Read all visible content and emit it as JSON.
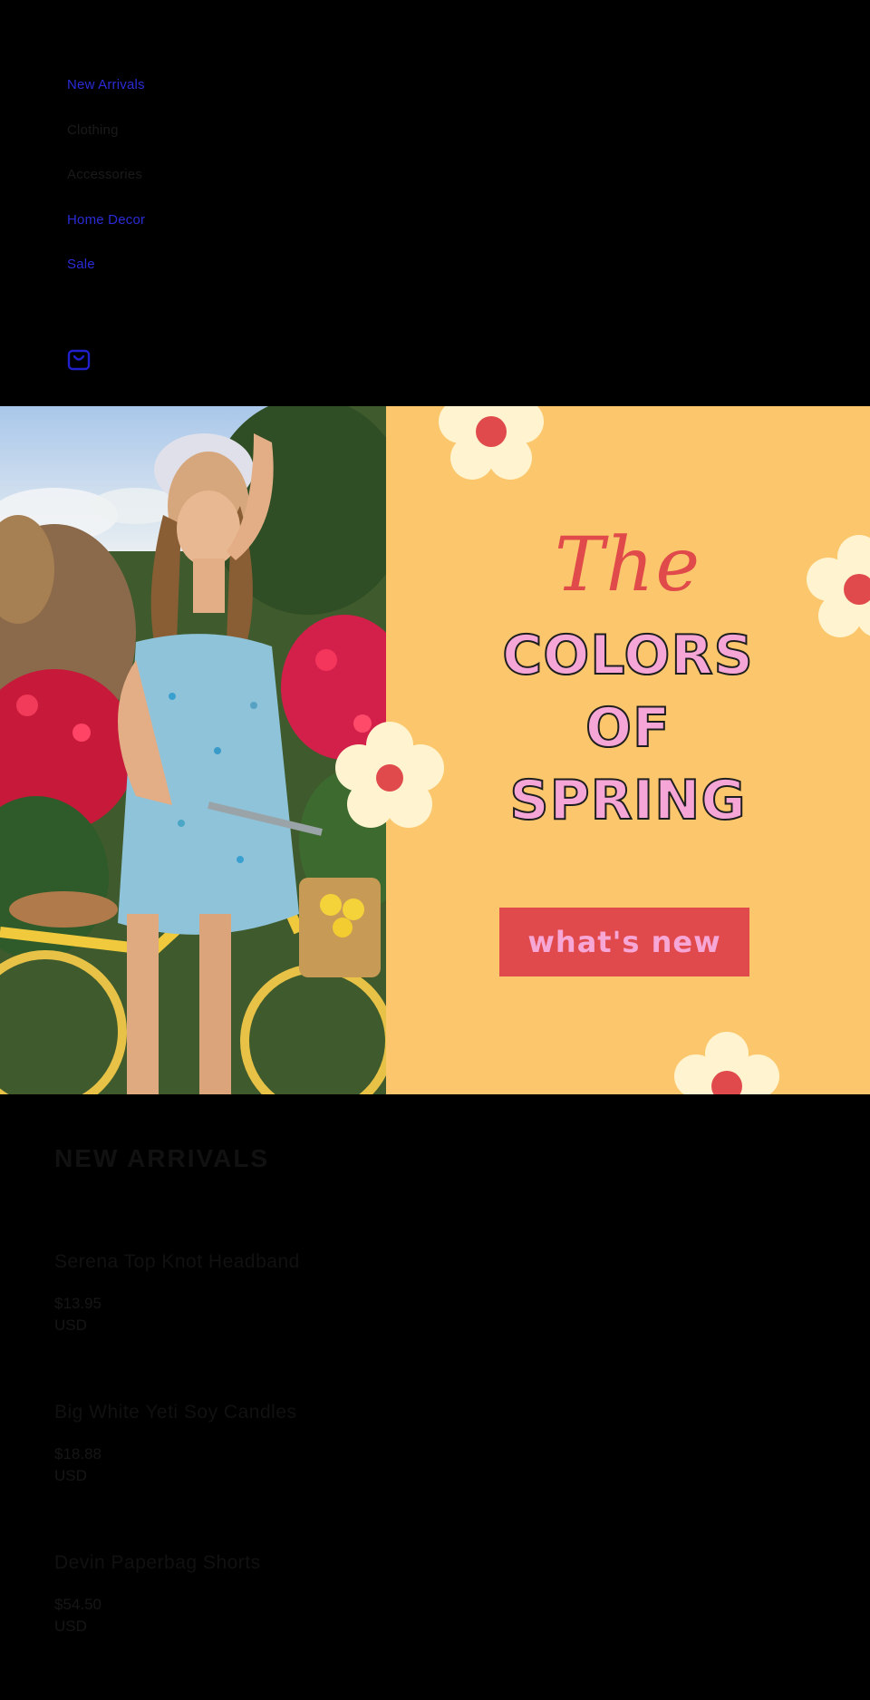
{
  "nav": {
    "items": [
      {
        "label": "New Arrivals"
      },
      {
        "label": "Clothing"
      },
      {
        "label": "Accessories"
      },
      {
        "label": "Home Decor"
      },
      {
        "label": "Sale"
      }
    ],
    "cart_icon": "shopping-bag-icon"
  },
  "hero": {
    "script_word": "The",
    "line1": "COLORS",
    "line2": "OF",
    "line3": "SPRING",
    "cta_label": "what's new",
    "colors": {
      "panel": "#fcc76c",
      "accent_red": "#e14a4d",
      "pink": "#f5a6d6",
      "flower_petal": "#fff4cf"
    }
  },
  "new_arrivals": {
    "title": "NEW ARRIVALS",
    "products": [
      {
        "name": "Serena Top Knot Headband",
        "price": "$13.95",
        "currency": "USD"
      },
      {
        "name": "Big White Yeti Soy Candles",
        "price": "$18.88",
        "currency": "USD"
      },
      {
        "name": "Devin Paperbag Shorts",
        "price": "$54.50",
        "currency": "USD"
      }
    ]
  }
}
